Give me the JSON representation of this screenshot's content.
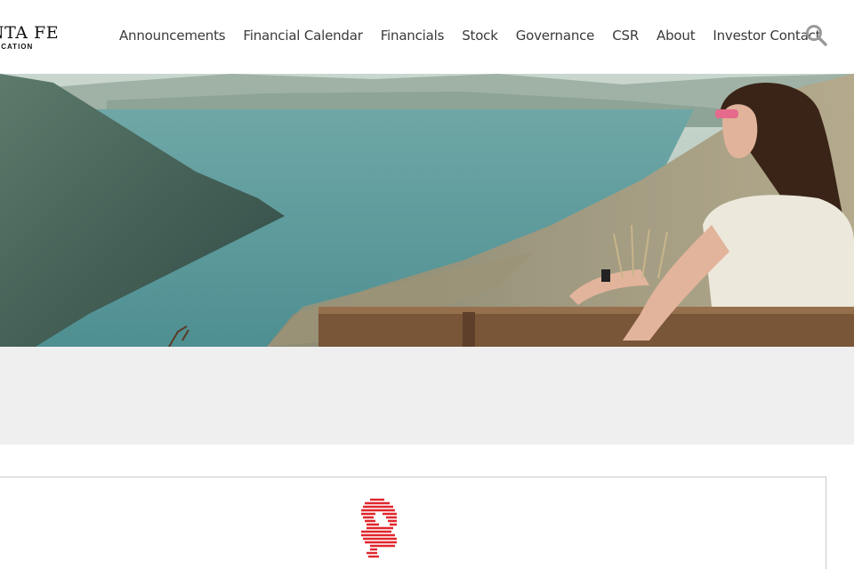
{
  "brand": {
    "name": "NTA FE",
    "tagline": "OCATION"
  },
  "nav": {
    "items": [
      "Announcements",
      "Financial Calendar",
      "Financials",
      "Stock",
      "Governance",
      "CSR",
      "About",
      "Investor Contact"
    ]
  },
  "icons": {
    "search": "search-icon",
    "emblem": "red-horse-emblem"
  },
  "colors": {
    "nav_text": "#3a3a3a",
    "band": "#efefef",
    "emblem": "#e0262d",
    "search": "#9a9a9a"
  }
}
